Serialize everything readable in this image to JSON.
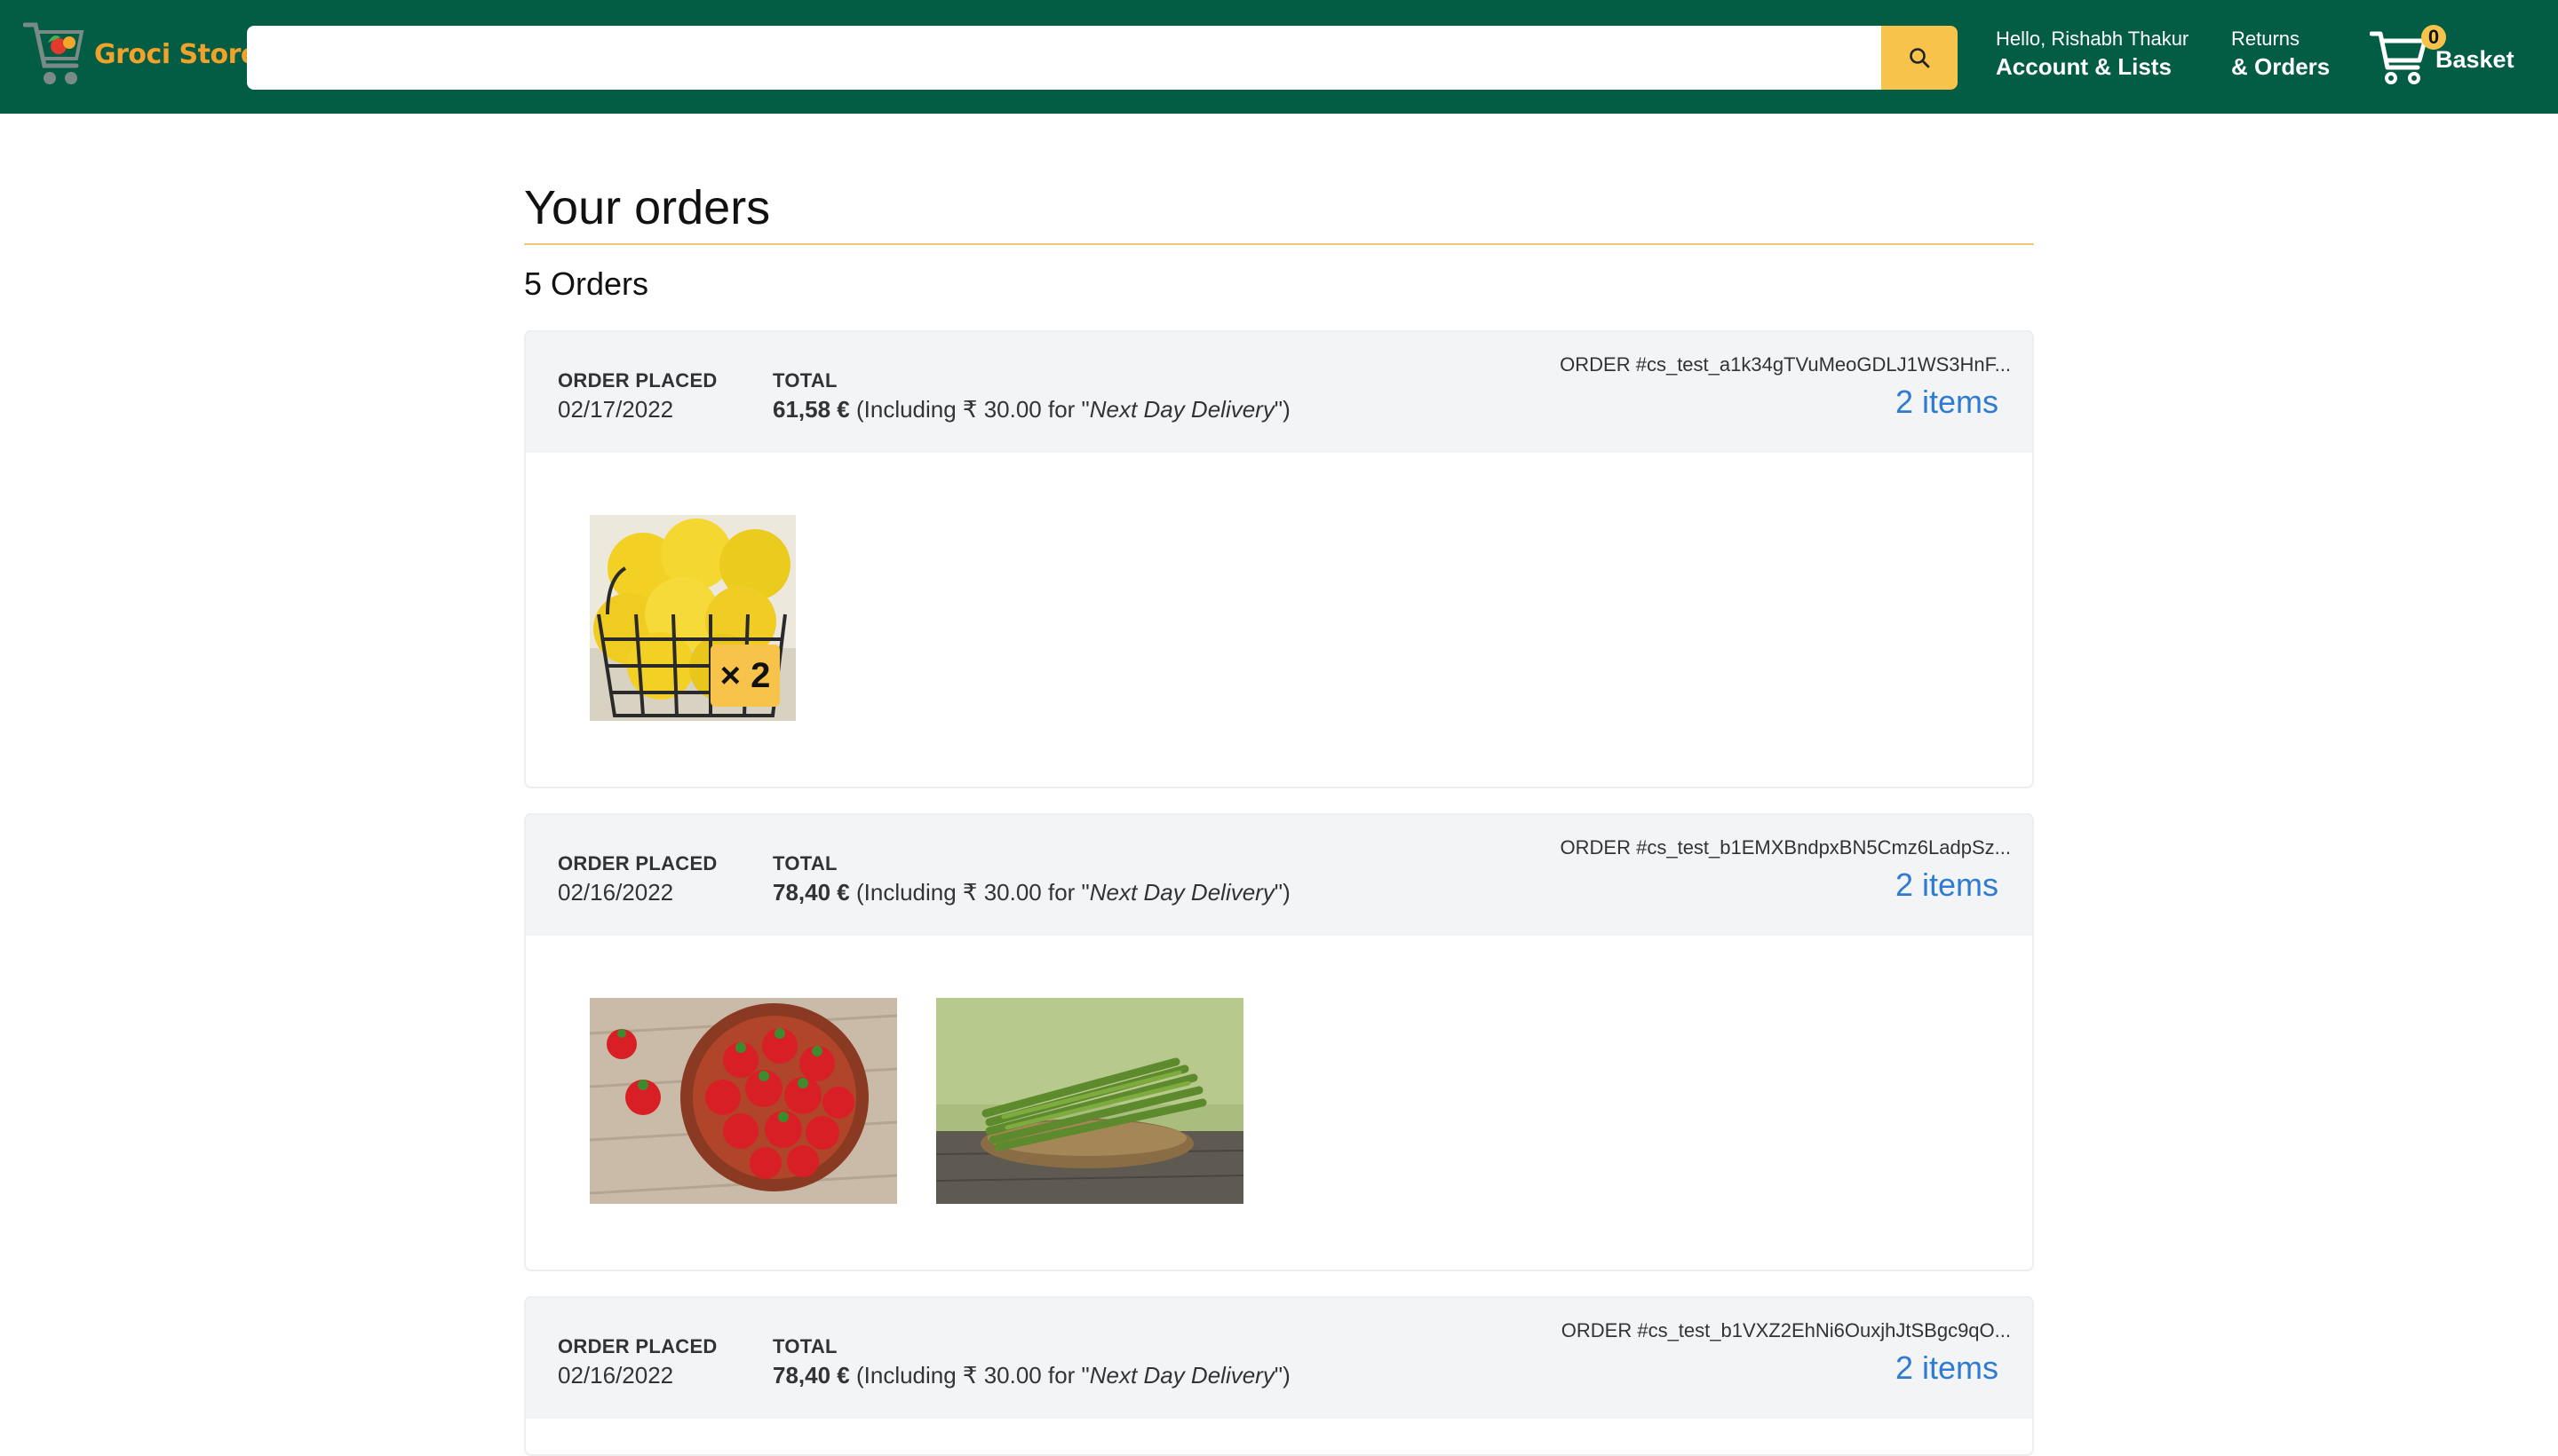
{
  "header": {
    "logo_text": "Groci Store",
    "search": {
      "placeholder": "",
      "value": ""
    },
    "account": {
      "greeting": "Hello, Rishabh Thakur",
      "label": "Account & Lists"
    },
    "returns": {
      "line1": "Returns",
      "line2": "& Orders"
    },
    "basket": {
      "count": "0",
      "label": "Basket"
    },
    "colors": {
      "header_bg": "#035d45",
      "accent": "#f7c34a",
      "link": "#2f7bd0"
    }
  },
  "main": {
    "title": "Your orders",
    "orders_count": "5 Orders",
    "orders": [
      {
        "placed_label": "ORDER PLACED",
        "placed_date": "02/17/2022",
        "total_label": "TOTAL",
        "total_amount": "61,58 €",
        "total_note_prefix": " (Including ₹ 30.00 for \"",
        "delivery_name": "Next Day Delivery",
        "total_note_suffix": "\")",
        "order_id": "ORDER #cs_test_a1k34gTVuMeoGDLJ1WS3HnF...",
        "items_label": "2 items",
        "products": [
          {
            "image": "lemons-in-wire-basket",
            "quantity": "× 2"
          }
        ]
      },
      {
        "placed_label": "ORDER PLACED",
        "placed_date": "02/16/2022",
        "total_label": "TOTAL",
        "total_amount": "78,40 €",
        "total_note_prefix": " (Including ₹ 30.00 for \"",
        "delivery_name": "Next Day Delivery",
        "total_note_suffix": "\")",
        "order_id": "ORDER #cs_test_b1EMXBndpxBN5Cmz6LadpSz...",
        "items_label": "2 items",
        "products": [
          {
            "image": "strawberries-in-bowl"
          },
          {
            "image": "asparagus-in-basket"
          }
        ]
      },
      {
        "placed_label": "ORDER PLACED",
        "placed_date": "02/16/2022",
        "total_label": "TOTAL",
        "total_amount": "78,40 €",
        "total_note_prefix": " (Including ₹ 30.00 for \"",
        "delivery_name": "Next Day Delivery",
        "total_note_suffix": "\")",
        "order_id": "ORDER #cs_test_b1VXZ2EhNi6OuxjhJtSBgc9qO...",
        "items_label": "2 items",
        "products": []
      }
    ]
  }
}
